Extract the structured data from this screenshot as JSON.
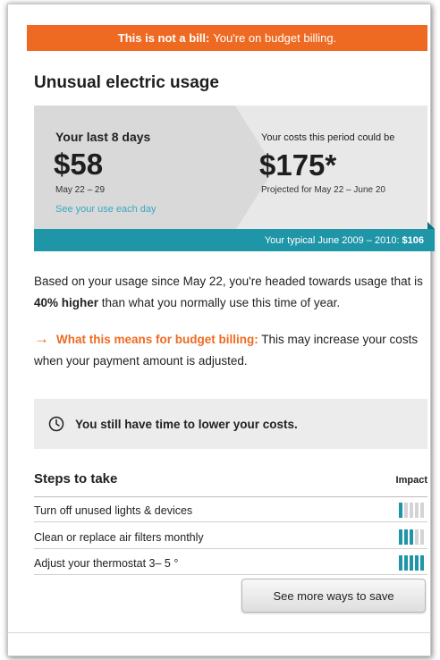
{
  "banner": {
    "bold": "This is not a bill:",
    "text": "You're on budget billing."
  },
  "title": "Unusual electric usage",
  "summary": {
    "last_label": "Your last 8 days",
    "last_amount": "$58",
    "last_range": "May 22 – 29",
    "see_use_link": "See your use each day",
    "proj_label": "Your costs this period could be",
    "proj_amount": "$175*",
    "proj_range": "Projected for May 22 – June 20",
    "typical_label": "Your typical June 2009 – 2010:",
    "typical_amount": "$106"
  },
  "usage_text": {
    "part1": "Based on your usage since May 22, you're headed towards usage that is ",
    "highlight": "40% higher",
    "part2": " than what you normally use this time of year."
  },
  "budget_note": {
    "lead": "What this means for budget billing:",
    "text": " This may increase your costs when your payment amount is adjusted."
  },
  "callout": {
    "icon": "clock-icon",
    "text": "You still have time to lower your costs."
  },
  "steps": {
    "title": "Steps to take",
    "impact_label": "Impact",
    "items": [
      {
        "label": "Turn off unused lights & devices",
        "impact": 1
      },
      {
        "label": "Clean or replace air filters monthly",
        "impact": 3
      },
      {
        "label": "Adjust your thermostat 3– 5 °",
        "impact": 5
      }
    ],
    "impact_max": 5
  },
  "more_button": "See more ways to save",
  "colors": {
    "accent": "#ee6a22",
    "teal": "#1f95a8",
    "link": "#3aa8bd"
  }
}
